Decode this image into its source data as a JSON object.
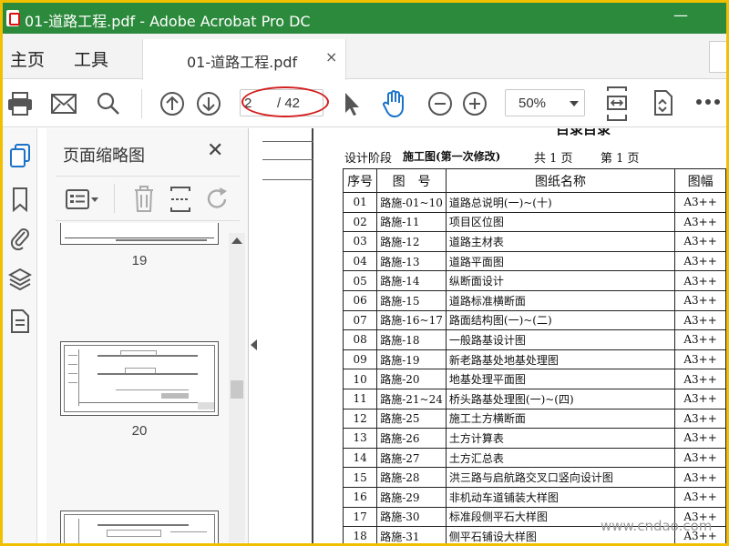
{
  "window": {
    "title": "01-道路工程.pdf - Adobe Acrobat Pro DC",
    "minimize_glyph": "—"
  },
  "tabs": {
    "home": "主页",
    "tools": "工具",
    "document": "01-道路工程.pdf",
    "close_glyph": "×"
  },
  "toolbar": {
    "page_current": "2",
    "page_total": "/ 42",
    "zoom": "50%",
    "icons": [
      "print-icon",
      "email-icon",
      "search-icon",
      "prev-page-icon",
      "next-page-icon",
      "select-cursor-icon",
      "hand-tool-icon",
      "zoom-out-icon",
      "zoom-in-icon",
      "page-fit-icon",
      "rotate-view-icon",
      "more-icon"
    ]
  },
  "rail": {
    "icons": [
      "page-thumbnails-icon",
      "bookmark-icon",
      "attachment-icon",
      "layers-icon",
      "document-properties-icon"
    ]
  },
  "thumbnails": {
    "title": "页面缩略图",
    "close_glyph": "✕",
    "pages": [
      "19",
      "20"
    ]
  },
  "document": {
    "header_fragment": "目录目录",
    "meta": {
      "stage_label": "设计阶段",
      "stage_value": "施工图(第一次修改)",
      "total": "共 1 页",
      "page": "第 1 页"
    },
    "columns": [
      "序号",
      "图　号",
      "图纸名称",
      "图幅"
    ],
    "rows": [
      [
        "01",
        "路施-01~10",
        "道路总说明(一)~(十)",
        "A3++"
      ],
      [
        "02",
        "路施-11",
        "项目区位图",
        "A3++"
      ],
      [
        "03",
        "路施-12",
        "道路主材表",
        "A3++"
      ],
      [
        "04",
        "路施-13",
        "道路平面图",
        "A3++"
      ],
      [
        "05",
        "路施-14",
        "纵断面设计",
        "A3++"
      ],
      [
        "06",
        "路施-15",
        "道路标准横断面",
        "A3++"
      ],
      [
        "07",
        "路施-16~17",
        "路面结构图(一)~(二)",
        "A3++"
      ],
      [
        "08",
        "路施-18",
        "一般路基设计图",
        "A3++"
      ],
      [
        "09",
        "路施-19",
        "新老路基处地基处理图",
        "A3++"
      ],
      [
        "10",
        "路施-20",
        "地基处理平面图",
        "A3++"
      ],
      [
        "11",
        "路施-21~24",
        "桥头路基处理图(一)~(四)",
        "A3++"
      ],
      [
        "12",
        "路施-25",
        "施工土方横断面",
        "A3++"
      ],
      [
        "13",
        "路施-26",
        "土方计算表",
        "A3++"
      ],
      [
        "14",
        "路施-27",
        "土方汇总表",
        "A3++"
      ],
      [
        "15",
        "路施-28",
        "洪三路与启航路交叉口竖向设计图",
        "A3++"
      ],
      [
        "16",
        "路施-29",
        "非机动车道铺装大样图",
        "A3++"
      ],
      [
        "17",
        "路施-30",
        "标准段侧平石大样图",
        "A3++"
      ],
      [
        "18",
        "路施-31",
        "侧平石铺设大样图",
        "A3++"
      ]
    ]
  },
  "watermark": "www.cndao.com"
}
